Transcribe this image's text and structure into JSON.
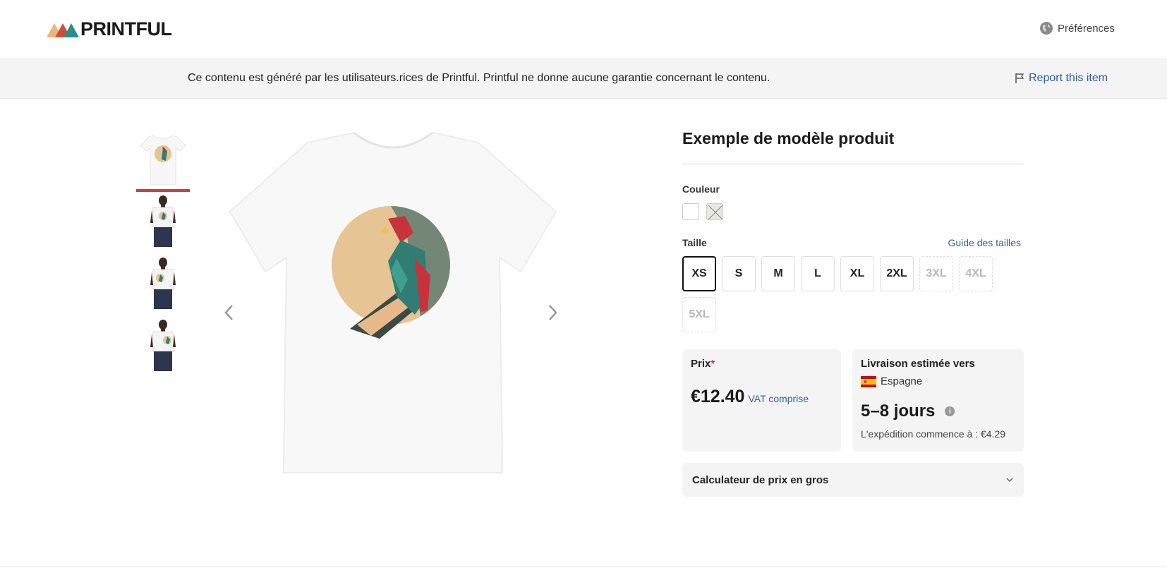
{
  "header": {
    "logo_text": "PRINTFUL",
    "preferences_label": "Préférences"
  },
  "notice": {
    "text": "Ce contenu est généré par les utilisateurs.rices de Printful. Printful ne donne aucune garantie concernant le contenu.",
    "report_label": "Report this item"
  },
  "product": {
    "title": "Exemple de modèle produit",
    "color_label": "Couleur",
    "size_label": "Taille",
    "size_guide_label": "Guide des tailles",
    "sizes": [
      {
        "label": "XS",
        "state": "selected"
      },
      {
        "label": "S",
        "state": "available"
      },
      {
        "label": "M",
        "state": "available"
      },
      {
        "label": "L",
        "state": "available"
      },
      {
        "label": "XL",
        "state": "available"
      },
      {
        "label": "2XL",
        "state": "available"
      },
      {
        "label": "3XL",
        "state": "disabled"
      },
      {
        "label": "4XL",
        "state": "disabled"
      },
      {
        "label": "5XL",
        "state": "disabled"
      }
    ]
  },
  "price": {
    "label": "Prix",
    "required_mark": "*",
    "value": "€12.40",
    "vat": "VAT comprise"
  },
  "shipping": {
    "label": "Livraison estimée vers",
    "country": "Espagne",
    "days": "5–8 jours",
    "start": "L'expédition commence à : €4.29"
  },
  "calculator": {
    "label": "Calculateur de prix en gros"
  },
  "colors": {
    "accent": "#c94040",
    "link": "#2c5ea8"
  }
}
